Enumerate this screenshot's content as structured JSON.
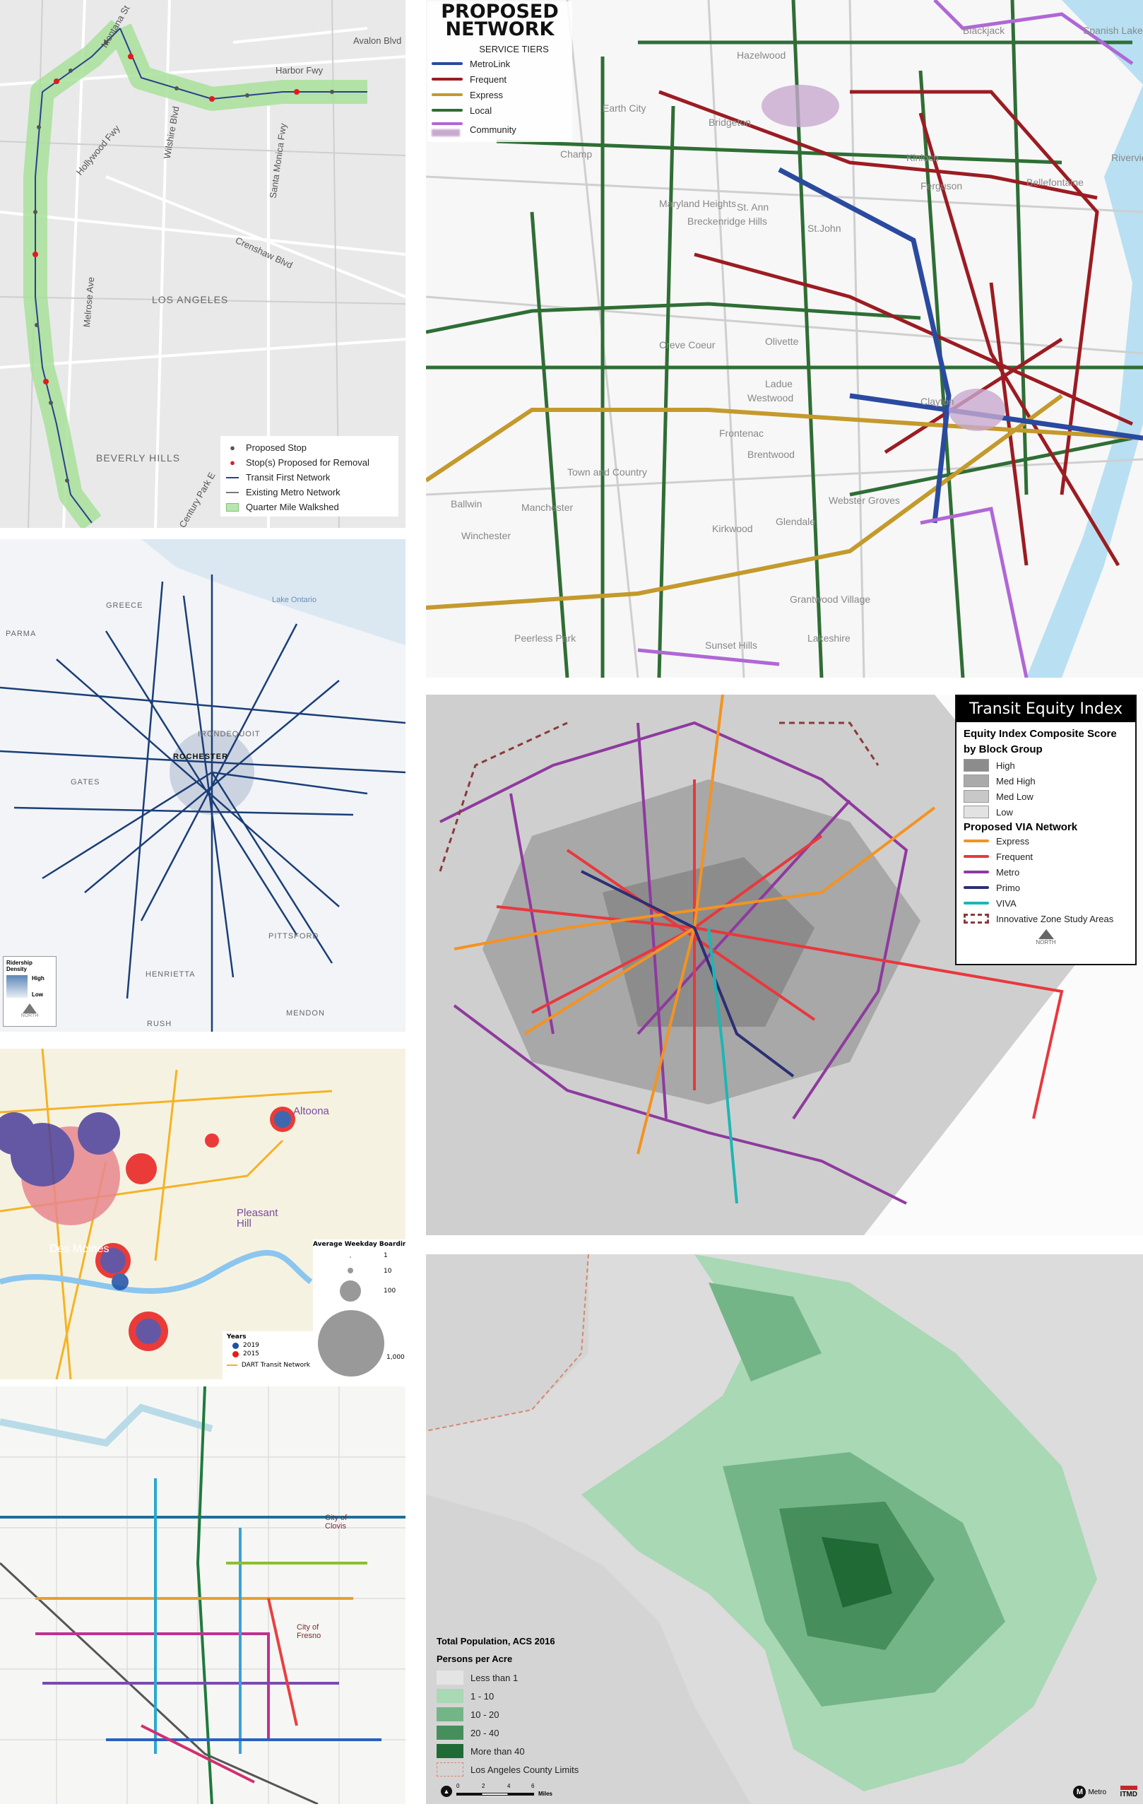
{
  "la_stops_map": {
    "place_labels": [
      "Montana St",
      "Harbor Fwy",
      "Avalon Blvd",
      "Hollywood Fwy",
      "Wilshire Blvd",
      "Santa Monica Fwy",
      "Crenshaw Blvd",
      "Melrose Ave",
      "LOS ANGELES",
      "BEVERLY HILLS",
      "Century Park E"
    ],
    "legend": [
      {
        "label": "Proposed Stop",
        "color": "#555555",
        "symbol": "dot"
      },
      {
        "label": "Stop(s) Proposed for Removal",
        "color": "#e31a1c",
        "symbol": "dot"
      },
      {
        "label": "Transit First Network",
        "color": "#2b3f8c",
        "symbol": "line"
      },
      {
        "label": "Existing Metro Network",
        "color": "#777777",
        "symbol": "line"
      },
      {
        "label": "Quarter Mile Walkshed",
        "color": "#b9e6b0",
        "symbol": "box"
      }
    ]
  },
  "stlouis_map": {
    "title_line1": "PROPOSED",
    "title_line2": "NETWORK",
    "legend_title": "SERVICE TIERS",
    "legend": [
      {
        "label": "MetroLink",
        "color": "#2a4aa0"
      },
      {
        "label": "Frequent",
        "color": "#9b1c22"
      },
      {
        "label": "Express",
        "color": "#c49a2c"
      },
      {
        "label": "Local",
        "color": "#2f6e35"
      },
      {
        "label": "Community",
        "color": "#b067d6"
      }
    ],
    "place_labels": [
      "Hazelwood",
      "Blackjack",
      "Spanish Lake",
      "Bridgeton",
      "Ferguson",
      "Kinloch",
      "Riverview",
      "Bellefontaine",
      "St. Ann",
      "Maryland Heights",
      "Breckenridge Hills",
      "St.John",
      "Creve Coeur",
      "Olivette",
      "Ladue",
      "Clayton",
      "Westwood",
      "Frontenac",
      "Brentwood",
      "Town and Country",
      "Manchester",
      "Ballwin",
      "Winchester",
      "Kirkwood",
      "Glendale",
      "Webster Groves",
      "Grantwood Village",
      "Lakeshire",
      "Peerless Park",
      "Sunset Hills",
      "Champ",
      "Earth City"
    ]
  },
  "rochester_map": {
    "place_labels": [
      "GREECE",
      "PARMA",
      "IRONDEQUOIT",
      "ROCHESTER",
      "GATES",
      "PITTSFORD",
      "HENRIETTA",
      "RUSH",
      "MENDON",
      "Lake Ontario"
    ],
    "legend_title": "Ridership Density",
    "legend_high": "High",
    "legend_low": "Low",
    "north": "NORTH"
  },
  "sanantonio_map": {
    "title": "Transit Equity Index",
    "score_title": "Equity Index Composite Score by Block Group",
    "score_classes": [
      {
        "label": "High",
        "color": "#8c8c8c"
      },
      {
        "label": "Med High",
        "color": "#aaaaaa"
      },
      {
        "label": "Med Low",
        "color": "#c8c8c8"
      },
      {
        "label": "Low",
        "color": "#e2e2e2"
      }
    ],
    "network_title": "Proposed VIA Network",
    "network": [
      {
        "label": "Express",
        "color": "#f39322"
      },
      {
        "label": "Frequent",
        "color": "#e8383d"
      },
      {
        "label": "Metro",
        "color": "#8e3a9e"
      },
      {
        "label": "Primo",
        "color": "#2b2f74"
      },
      {
        "label": "VIVA",
        "color": "#1fb5b5"
      }
    ],
    "zone_label": "Innovative Zone Study Areas",
    "zone_color": "#8a3a3a",
    "north": "NORTH"
  },
  "desmoines_map": {
    "place_labels": [
      "Altoona",
      "Pleasant Hill",
      "Des Moines"
    ],
    "size_title": "Average Weekday Boardings",
    "sizes": [
      "1",
      "10",
      "100",
      "1,000"
    ],
    "years_title": "Years",
    "years": [
      {
        "label": "2019",
        "color": "#1f4fa8"
      },
      {
        "label": "2015",
        "color": "#e81c1c"
      }
    ],
    "network_label": "DART Transit Network",
    "network_color": "#f5b323"
  },
  "fresno_map": {
    "place_labels": [
      "City of Clovis",
      "City of Fresno"
    ]
  },
  "la_population_map": {
    "title": "Total Population, ACS 2016",
    "subtitle": "Persons per Acre",
    "classes": [
      {
        "label": "Less than 1",
        "color": "#e4e4e4"
      },
      {
        "label": "1 - 10",
        "color": "#a8d8b4"
      },
      {
        "label": "10 - 20",
        "color": "#74b588"
      },
      {
        "label": "20 - 40",
        "color": "#468e5c"
      },
      {
        "label": "More than 40",
        "color": "#1f6a35"
      }
    ],
    "county_label": "Los Angeles County Limits",
    "scale_ticks": [
      "0",
      "2",
      "4",
      "6"
    ],
    "scale_unit": "Miles",
    "logos": [
      "Metro",
      "ITMD"
    ]
  }
}
